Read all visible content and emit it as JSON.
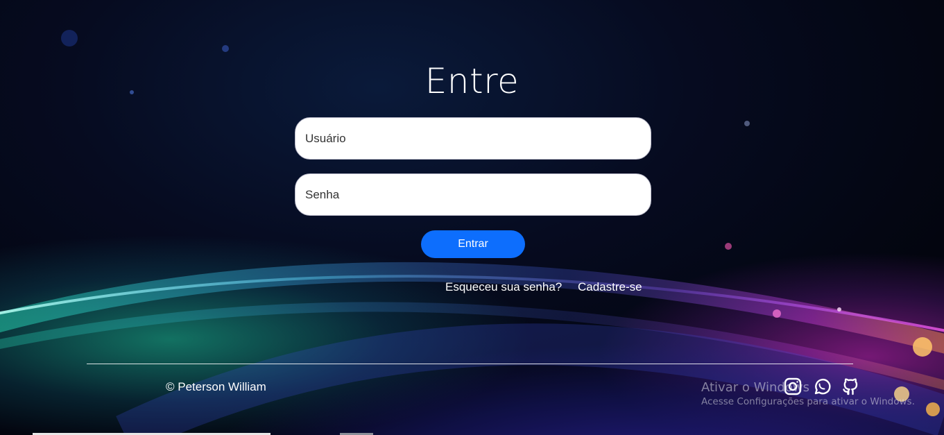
{
  "login": {
    "title": "Entre",
    "username_placeholder": "Usuário",
    "password_placeholder": "Senha",
    "submit_label": "Entrar",
    "forgot_label": "Esqueceu sua senha?",
    "signup_label": "Cadastre-se"
  },
  "footer": {
    "copyright": "© Peterson William",
    "social_icons": [
      "instagram-icon",
      "whatsapp-icon",
      "github-icon"
    ]
  },
  "overlay": {
    "activation_title": "Ativar o Windows",
    "activation_subtitle": "Acesse Configurações para ativar o Windows."
  },
  "colors": {
    "button": "#0d6efd",
    "text": "#ffffff",
    "field_bg": "#ffffff"
  }
}
